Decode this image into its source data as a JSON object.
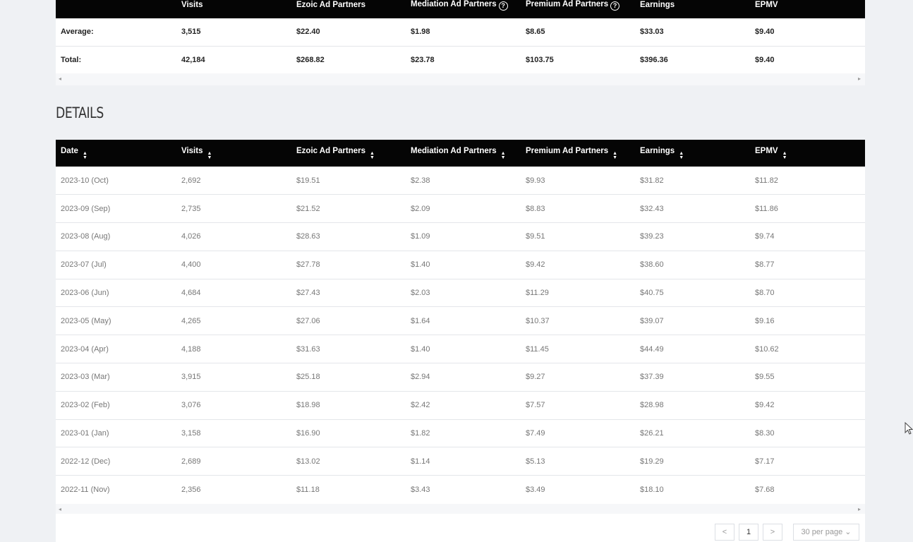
{
  "summary": {
    "headers": [
      "",
      "Visits",
      "Ezoic Ad Partners",
      "Mediation Ad Partners",
      "Premium Ad Partners",
      "Earnings",
      "EPMV"
    ],
    "rows": [
      [
        "Average:",
        "3,515",
        "$22.40",
        "$1.98",
        "$8.65",
        "$33.03",
        "$9.40"
      ],
      [
        "Total:",
        "42,184",
        "$268.82",
        "$23.78",
        "$103.75",
        "$396.36",
        "$9.40"
      ]
    ],
    "help_icon": "?"
  },
  "details": {
    "title": "DETAILS",
    "headers": [
      "Date",
      "Visits",
      "Ezoic Ad Partners",
      "Mediation Ad Partners",
      "Premium Ad Partners",
      "Earnings",
      "EPMV"
    ],
    "rows": [
      [
        "2023-10 (Oct)",
        "2,692",
        "$19.51",
        "$2.38",
        "$9.93",
        "$31.82",
        "$11.82"
      ],
      [
        "2023-09 (Sep)",
        "2,735",
        "$21.52",
        "$2.09",
        "$8.83",
        "$32.43",
        "$11.86"
      ],
      [
        "2023-08 (Aug)",
        "4,026",
        "$28.63",
        "$1.09",
        "$9.51",
        "$39.23",
        "$9.74"
      ],
      [
        "2023-07 (Jul)",
        "4,400",
        "$27.78",
        "$1.40",
        "$9.42",
        "$38.60",
        "$8.77"
      ],
      [
        "2023-06 (Jun)",
        "4,684",
        "$27.43",
        "$2.03",
        "$11.29",
        "$40.75",
        "$8.70"
      ],
      [
        "2023-05 (May)",
        "4,265",
        "$27.06",
        "$1.64",
        "$10.37",
        "$39.07",
        "$9.16"
      ],
      [
        "2023-04 (Apr)",
        "4,188",
        "$31.63",
        "$1.40",
        "$11.45",
        "$44.49",
        "$10.62"
      ],
      [
        "2023-03 (Mar)",
        "3,915",
        "$25.18",
        "$2.94",
        "$9.27",
        "$37.39",
        "$9.55"
      ],
      [
        "2023-02 (Feb)",
        "3,076",
        "$18.98",
        "$2.42",
        "$7.57",
        "$28.98",
        "$9.42"
      ],
      [
        "2023-01 (Jan)",
        "3,158",
        "$16.90",
        "$1.82",
        "$7.49",
        "$26.21",
        "$8.30"
      ],
      [
        "2022-12 (Dec)",
        "2,689",
        "$13.02",
        "$1.14",
        "$5.13",
        "$19.29",
        "$7.17"
      ],
      [
        "2022-11 (Nov)",
        "2,356",
        "$11.18",
        "$3.43",
        "$3.49",
        "$18.10",
        "$7.68"
      ]
    ]
  },
  "pagination": {
    "prev": "<",
    "page": "1",
    "next": ">",
    "per_page": "30 per page"
  },
  "scroll": {
    "left": "◂",
    "right": "▸"
  },
  "sort_glyphs": {
    "up": "▲",
    "down": "▼"
  }
}
